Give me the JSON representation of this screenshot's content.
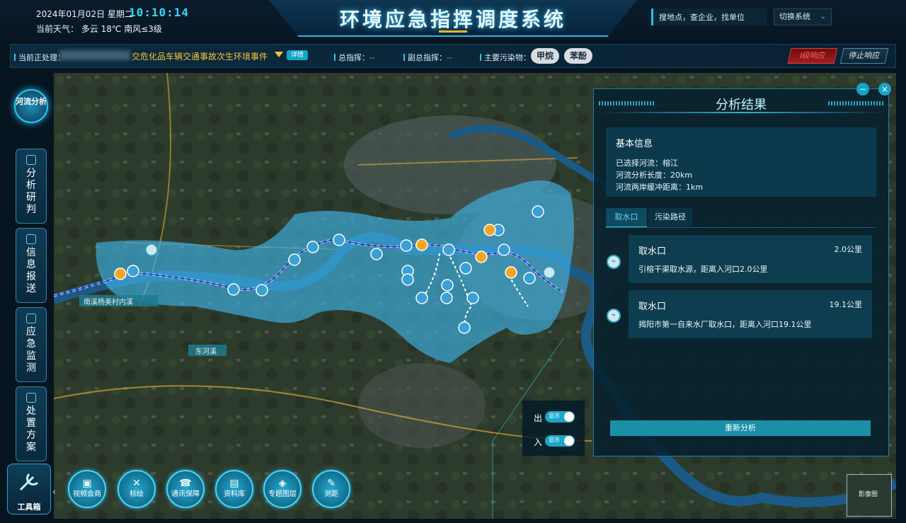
{
  "header": {
    "date": "2024年01月02日 星期二",
    "clock": "10:10:14",
    "weather": "当前天气：  多云 18℃ 南风≤3级",
    "title": "环境应急指挥调度系统",
    "search_placeholder": "搜地点，查企业，找单位",
    "switch_system": "切换系统"
  },
  "event_bar": {
    "processing_label": "当前正处理：",
    "event_name": "交危化品车辆交通事故次生环境事件",
    "detail_button": "详情",
    "commander_label": "总指挥：",
    "commander_value": "--",
    "deputy_label": "副总指挥：",
    "deputy_value": "--",
    "pollutant_label": "主要污染物：",
    "pollutants": [
      "甲烷",
      "苯酚"
    ],
    "level_button": "Ⅰ级响应",
    "stop_button": "停止响应"
  },
  "left_nav": {
    "river_analysis": "河流分析",
    "items": [
      "分析研判",
      "信息报送",
      "应急监测",
      "处置方案"
    ],
    "toolbox": "工具箱"
  },
  "bottom_tools": [
    {
      "label": "视频会商",
      "icon": "video-icon"
    },
    {
      "label": "标绘",
      "icon": "plot-icon"
    },
    {
      "label": "通讯保障",
      "icon": "phone-icon"
    },
    {
      "label": "资料库",
      "icon": "book-icon"
    },
    {
      "label": "专题图层",
      "icon": "layers-icon"
    },
    {
      "label": "测距",
      "icon": "ruler-icon"
    }
  ],
  "panel": {
    "title": "分析结果",
    "basic_title": "基本信息",
    "river_selected": "已选择河流：榕江",
    "analysis_length": "河流分析长度：20km",
    "buffer": "河流两岸缓冲距离：1km",
    "tabs": [
      "取水口",
      "污染路径"
    ],
    "cards": [
      {
        "title": "取水口",
        "distance": "2.0公里",
        "desc": "引榕干渠取水源，距离入河口2.0公里"
      },
      {
        "title": "取水口",
        "distance": "19.1公里",
        "desc": "揭阳市第一自来水厂取水口，距离入河口19.1公里"
      }
    ],
    "reanalyze": "重新分析"
  },
  "legend": {
    "out_label": "出",
    "in_label": "入",
    "toggle_text": "显示"
  },
  "map_labels": {
    "river_1": "南溪杨美村内溪",
    "river_2": "东河溪",
    "minimap": "影像图"
  },
  "colors": {
    "accent": "#2bc7ee",
    "buffer": "#3fb3e6",
    "outlet": "#f5a623",
    "inlet": "#3aa0d8",
    "warning": "#f5c33a"
  }
}
